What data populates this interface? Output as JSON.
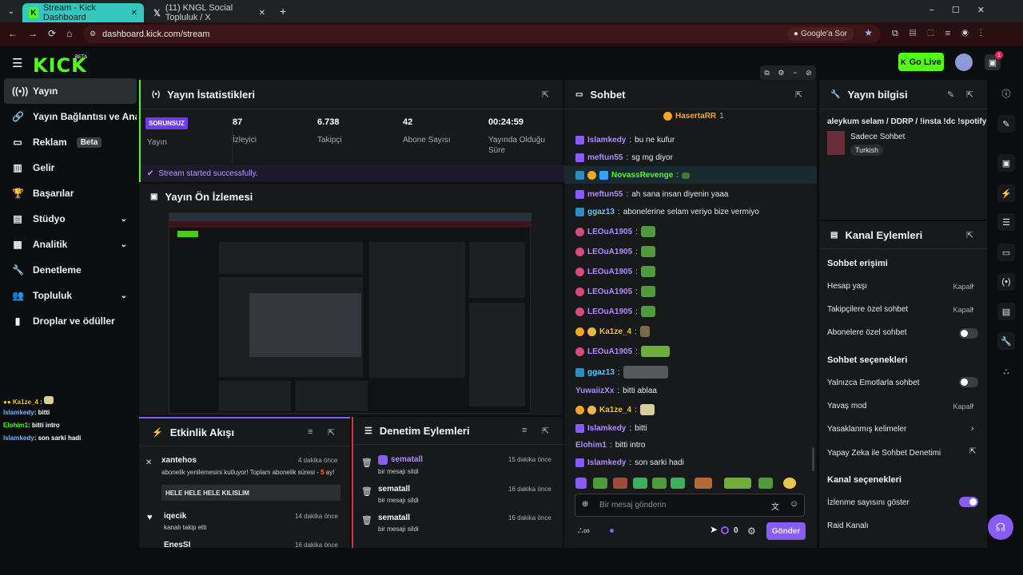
{
  "browser": {
    "tabs": [
      {
        "label": "Stream - Kick Dashboard"
      },
      {
        "label": "(11) KNGL Social Topluluk / X"
      }
    ],
    "url": "dashboard.kick.com/stream",
    "search_chip": "Google'a Sor"
  },
  "app": {
    "logo": "KICK",
    "logo_badge": "BETA",
    "go_live": "Go Live",
    "notif_count": "1"
  },
  "sidebar": {
    "items": [
      {
        "label": "Yayın",
        "icon": "broadcast-icon"
      },
      {
        "label": "Yayın Bağlantısı ve Anahtar",
        "icon": "link-icon"
      },
      {
        "label": "Reklam",
        "badge": "Beta",
        "icon": "ad-icon"
      },
      {
        "label": "Gelir",
        "icon": "chart-icon"
      },
      {
        "label": "Başarılar",
        "icon": "trophy-icon"
      },
      {
        "label": "Stüdyo",
        "icon": "studio-icon"
      },
      {
        "label": "Analitik",
        "icon": "analytics-icon"
      },
      {
        "label": "Denetleme",
        "icon": "wrench-icon"
      },
      {
        "label": "Topluluk",
        "icon": "community-icon"
      },
      {
        "label": "Droplar ve ödüller",
        "icon": "drop-icon"
      }
    ]
  },
  "overlay_chat": [
    {
      "user": "Ka1ze_4",
      "text": ":",
      "color": "#f5c518"
    },
    {
      "user": "Islamkedy",
      "text": ": bitti",
      "color": "#6fb8ff"
    },
    {
      "user": "Elohim1",
      "text": ": bitti intro",
      "color": "#53fc18"
    },
    {
      "user": "Islamkedy",
      "text": ": son sarki hadi",
      "color": "#6fb8ff"
    }
  ],
  "stats": {
    "title": "Yayın İstatistikleri",
    "status_badge": "SORUNSUZ",
    "status_label": "Yayın",
    "items": [
      {
        "value": "87",
        "label": "İzleyici"
      },
      {
        "value": "6.738",
        "label": "Takipçi"
      },
      {
        "value": "42",
        "label": "Abone Sayısı"
      },
      {
        "value": "00:24:59",
        "label": "Yayında Olduğu Süre"
      }
    ],
    "success": "Stream started successfully."
  },
  "preview": {
    "title": "Yayın Ön İzlemesi"
  },
  "activity": {
    "title": "Etkinlik Akışı",
    "items": [
      {
        "user": "xantehos",
        "time": "4 dakika önce",
        "text": "abonelik yenilemesini kutluyor! Toplam abonelik süresi -",
        "months": "5",
        "suffix": "ay!",
        "quote": "HELE HELE HELE KILISLIM"
      },
      {
        "user": "iqecik",
        "time": "14 dakika önce",
        "text": "kanalı takip etti"
      },
      {
        "user": "EnesSI",
        "time": "16 dakika önce",
        "text": ""
      }
    ]
  },
  "moderation": {
    "title": "Denetim Eylemleri",
    "items": [
      {
        "user": "sematall",
        "time": "15 dakika önce",
        "text": "bir mesajı sildi"
      },
      {
        "user": "sematall",
        "time": "16 dakika önce",
        "text": "bir mesajı sildi"
      },
      {
        "user": "sematall",
        "time": "16 dakika önce",
        "text": "bir mesajı sildi"
      }
    ]
  },
  "chat": {
    "title": "Sohbet",
    "pinned_user": "HasertaRR",
    "pinned_count": "1",
    "messages": [
      {
        "user": "Islamkedy",
        "text": "bu ne kufur",
        "color": "#b18cff"
      },
      {
        "user": "meftun55",
        "text": "sg mg diyor",
        "color": "#b18cff"
      },
      {
        "user": "NovassRevenge",
        "text": "",
        "color": "#53fc18"
      },
      {
        "user": "meftun55",
        "text": "ah sana insan diyenin yaaa",
        "color": "#b18cff"
      },
      {
        "user": "ggaz13",
        "text": "abonelerine selam veriyo bize vermiyo",
        "color": "#5fc8ff"
      },
      {
        "user": "LEOuA1905",
        "text": "",
        "color": "#b18cff"
      },
      {
        "user": "LEOuA1905",
        "text": "",
        "color": "#b18cff"
      },
      {
        "user": "LEOuA1905",
        "text": "",
        "color": "#b18cff"
      },
      {
        "user": "LEOuA1905",
        "text": "",
        "color": "#b18cff"
      },
      {
        "user": "LEOuA1905",
        "text": "",
        "color": "#b18cff"
      },
      {
        "user": "Ka1ze_4",
        "text": "",
        "color": "#f5c518"
      },
      {
        "user": "LEOuA1905",
        "text": "",
        "color": "#b18cff"
      },
      {
        "user": "ggaz13",
        "text": "",
        "color": "#5fc8ff"
      },
      {
        "user": "YuwaiizXx",
        "text": "bitti ablaa",
        "color": "#b18cff"
      },
      {
        "user": "Ka1ze_4",
        "text": "",
        "color": "#f5c518"
      },
      {
        "user": "Islamkedy",
        "text": "bitti",
        "color": "#b18cff"
      },
      {
        "user": "Elohim1",
        "text": "bitti intro",
        "color": "#b18cff"
      },
      {
        "user": "Islamkedy",
        "text": "son sarki hadi",
        "color": "#b18cff"
      }
    ],
    "input_placeholder": "Bir mesaj gönderin",
    "points": "0",
    "send": "Gönder"
  },
  "info": {
    "title": "Yayın bilgisi",
    "stream_title": "aleykum selam / DDRP / !insta !dc !spotify",
    "category": "Sadece Sohbet",
    "language": "Turkish"
  },
  "channel_actions": {
    "title": "Kanal Eylemleri",
    "chat_access": "Sohbet erişimi",
    "account_age": "Hesap yaşı",
    "account_age_value": "Kapalı",
    "followers_only": "Takipçilere özel sohbet",
    "followers_only_value": "Kapalı",
    "subs_only": "Abonelere özel sohbet",
    "chat_options": "Sohbet seçenekleri",
    "emotes_only": "Yalnızca Emotlarla sohbet",
    "slow_mode": "Yavaş mod",
    "slow_mode_value": "Kapalı",
    "banned_words": "Yasaklanmış kelimeler",
    "ai_moderation": "Yapay Zeka ile Sohbet Denetimi",
    "channel_options": "Kanal seçenekleri",
    "show_viewers": "İzlenme sayısını göster",
    "raid": "Raid Kanalı"
  },
  "colors": {
    "accent": "#53fc18",
    "purple": "#8a5cf6",
    "panel": "#17191b",
    "bg": "#0b0e0f"
  }
}
